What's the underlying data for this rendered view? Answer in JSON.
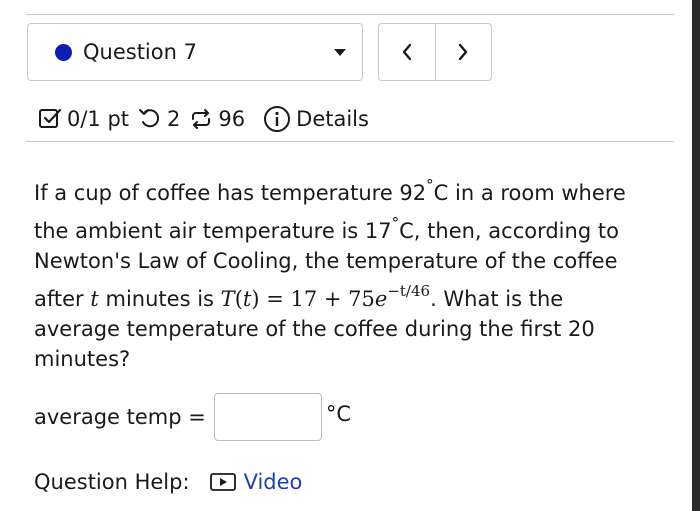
{
  "header": {
    "question_label": "Question 7",
    "prev_label": "‹",
    "next_label": "›",
    "points": "0/1 pt",
    "retries": "2",
    "attempts": "96",
    "details_label": "Details",
    "status_color": "#0b1fb0",
    "icons": [
      "checkbox-icon",
      "retry-icon",
      "attempts-icon",
      "info-icon"
    ]
  },
  "question": {
    "t1": "If a cup of coffee has temperature 92",
    "deg1": "°",
    "t2": "C in a room where the ambient air temperature is 17",
    "deg2": "°",
    "t3": "C, then, according to Newton's Law of Cooling, the temperature of the coffee after",
    "var_t": "t",
    "t4": "minutes is",
    "formula_T": "T",
    "formula_paren_open": "(",
    "formula_t": "t",
    "formula_rest": ") = 17 + 75",
    "formula_e": "e",
    "formula_exp": "−t/46",
    "t5": ". What is the average temperature of the coffee during the first 20 minutes?"
  },
  "answer": {
    "label": "average temp =",
    "value": "",
    "placeholder": "",
    "unit": "°C"
  },
  "help": {
    "label": "Question Help:",
    "video_label": "Video",
    "link_color": "#1f3fb5"
  }
}
